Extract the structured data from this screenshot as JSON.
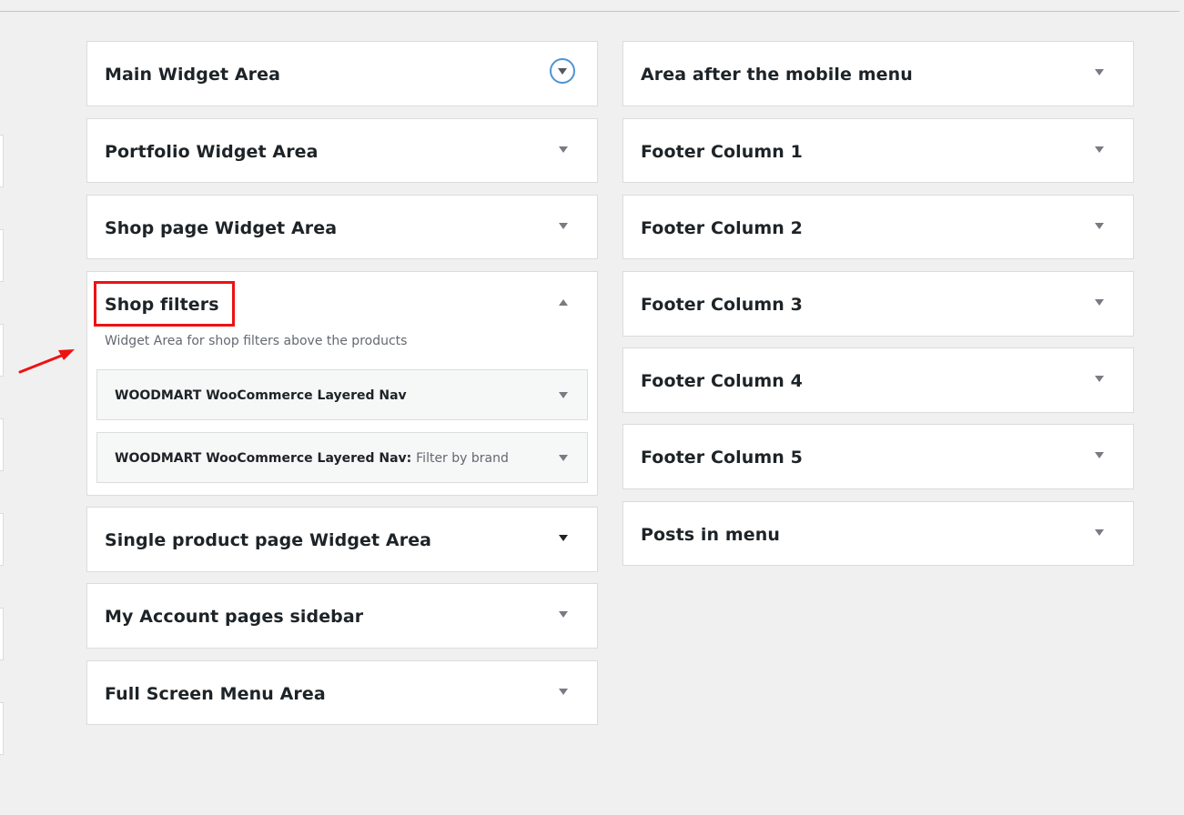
{
  "left_column": [
    {
      "title": "Main Widget Area",
      "toggle": "circle-chevron-down-icon"
    },
    {
      "title": "Portfolio Widget Area",
      "toggle": "chevron-down-icon"
    },
    {
      "title": "Shop page Widget Area",
      "toggle": "chevron-down-icon"
    },
    {
      "title": "Shop filters",
      "toggle": "chevron-up-icon",
      "description": "Widget Area for shop filters above the products",
      "widgets": [
        {
          "title": "WOODMART WooCommerce Layered Nav",
          "subtitle": ""
        },
        {
          "title": "WOODMART WooCommerce Layered Nav:",
          "subtitle": "Filter by brand"
        }
      ]
    },
    {
      "title": "Single product page Widget Area",
      "toggle": "chevron-down-icon"
    },
    {
      "title": "My Account pages sidebar",
      "toggle": "chevron-down-icon"
    },
    {
      "title": "Full Screen Menu Area",
      "toggle": "chevron-down-icon"
    }
  ],
  "right_column": [
    {
      "title": "Area after the mobile menu",
      "toggle": "chevron-down-icon"
    },
    {
      "title": "Footer Column 1",
      "toggle": "chevron-down-icon"
    },
    {
      "title": "Footer Column 2",
      "toggle": "chevron-down-icon"
    },
    {
      "title": "Footer Column 3",
      "toggle": "chevron-down-icon"
    },
    {
      "title": "Footer Column 4",
      "toggle": "chevron-down-icon"
    },
    {
      "title": "Footer Column 5",
      "toggle": "chevron-down-icon"
    },
    {
      "title": "Posts in menu",
      "toggle": "chevron-down-icon"
    }
  ],
  "annotation": {
    "highlight_color": "#ee1111",
    "arrow_color": "#ee1111"
  },
  "colors": {
    "background": "#f0f0f1",
    "panel": "#ffffff",
    "border": "#dcdcde",
    "focus": "#4f94d4"
  }
}
